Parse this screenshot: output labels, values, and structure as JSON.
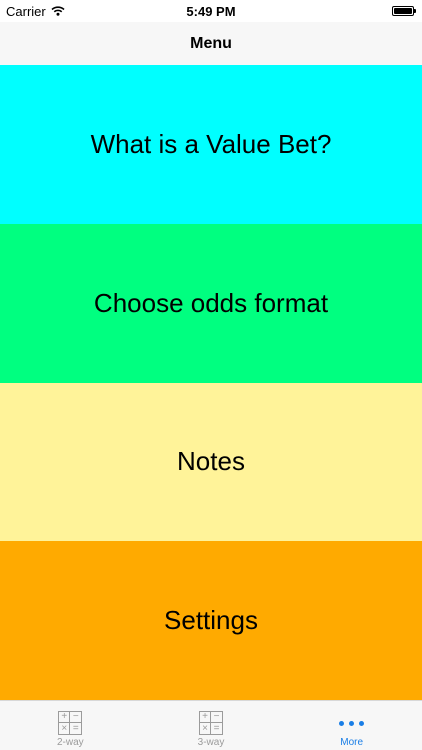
{
  "status_bar": {
    "carrier": "Carrier",
    "time": "5:49 PM",
    "icons": [
      "wifi-icon",
      "battery-icon"
    ],
    "battery_level": 1.0
  },
  "nav": {
    "title": "Menu"
  },
  "menu": {
    "items": [
      {
        "label": "What is a Value Bet?",
        "color": "#00FFFF"
      },
      {
        "label": "Choose odds format",
        "color": "#00FF80"
      },
      {
        "label": "Notes",
        "color": "#FFF399"
      },
      {
        "label": "Settings",
        "color": "#FFAA00"
      }
    ]
  },
  "tab_bar": {
    "active_color": "#1A7EE6",
    "inactive_color": "#9B9B9B",
    "tabs": [
      {
        "label": "2-way",
        "icon": "calculator-icon",
        "active": false
      },
      {
        "label": "3-way",
        "icon": "calculator-icon",
        "active": false
      },
      {
        "label": "More",
        "icon": "more-icon",
        "active": true
      }
    ],
    "calc_icon_glyphs": [
      "+",
      "−",
      "×",
      "="
    ]
  }
}
